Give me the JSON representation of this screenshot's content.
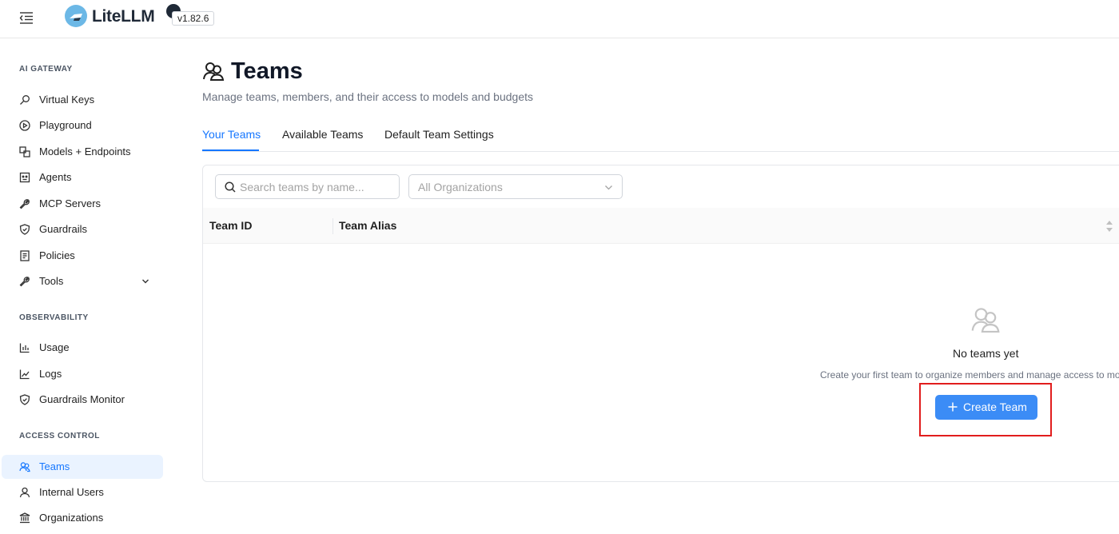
{
  "header": {
    "brand": "LiteLLM",
    "version": "v1.82.6"
  },
  "sidebar": {
    "sections": [
      {
        "title": "AI GATEWAY"
      },
      {
        "title": "OBSERVABILITY"
      },
      {
        "title": "ACCESS CONTROL"
      }
    ],
    "items": [
      {
        "label": "Virtual Keys",
        "icon": "key-icon"
      },
      {
        "label": "Playground",
        "icon": "play-circle-icon"
      },
      {
        "label": "Models + Endpoints",
        "icon": "block-icon"
      },
      {
        "label": "Agents",
        "icon": "robot-icon"
      },
      {
        "label": "MCP Servers",
        "icon": "tool-icon"
      },
      {
        "label": "Guardrails",
        "icon": "shield-icon"
      },
      {
        "label": "Policies",
        "icon": "file-icon"
      },
      {
        "label": "Tools",
        "icon": "wrench-icon"
      },
      {
        "label": "Usage",
        "icon": "bar-chart-icon"
      },
      {
        "label": "Logs",
        "icon": "line-chart-icon"
      },
      {
        "label": "Guardrails Monitor",
        "icon": "shield-icon"
      },
      {
        "label": "Teams",
        "icon": "team-icon",
        "active": true
      },
      {
        "label": "Internal Users",
        "icon": "user-icon"
      },
      {
        "label": "Organizations",
        "icon": "bank-icon"
      }
    ]
  },
  "page": {
    "title": "Teams",
    "subtitle": "Manage teams, members, and their access to models and budgets"
  },
  "tabs": [
    {
      "label": "Your Teams",
      "active": true
    },
    {
      "label": "Available Teams"
    },
    {
      "label": "Default Team Settings"
    }
  ],
  "filters": {
    "search_placeholder": "Search teams by name...",
    "org_select": "All Organizations"
  },
  "table": {
    "columns": [
      "Team ID",
      "Team Alias"
    ]
  },
  "empty_state": {
    "title": "No teams yet",
    "description": "Create your first team to organize members and manage access to models",
    "button": "Create Team"
  },
  "colors": {
    "accent": "#1677ff",
    "button": "#3b8cf6",
    "highlight": "#e11d1d"
  }
}
